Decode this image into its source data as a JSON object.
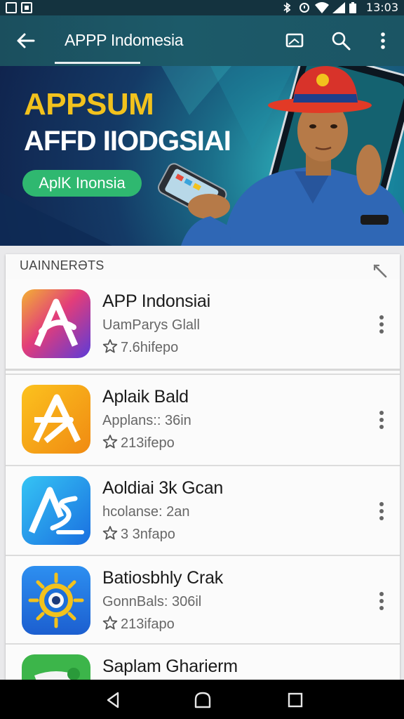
{
  "status_bar": {
    "time": "13:03",
    "icons": [
      "notification-square-icon",
      "image-notification-icon",
      "bluetooth-icon",
      "alarm-icon",
      "wifi-icon",
      "signal-icon",
      "battery-icon"
    ]
  },
  "app_bar": {
    "title": "APPP Indomesia",
    "icons": [
      "back-arrow-icon",
      "cast-icon",
      "search-icon",
      "more-vert-icon"
    ]
  },
  "banner": {
    "headline_1": "APPSUM",
    "headline_2": "AFFD IIODGSIAI",
    "cta_label": "AplK Inonsia"
  },
  "list": {
    "header": "UAINNERƏTS",
    "apps": [
      {
        "name": "APP Indonsiai",
        "developer": "UamParys Glall",
        "rating": "7.6hifepo",
        "icon": "letter-a-gradient-icon"
      },
      {
        "name": "Aplaik Bald",
        "developer": "Applans:: 36in",
        "rating": "213ifepo",
        "icon": "letter-a-orange-icon"
      },
      {
        "name": "Aoldiai 3k Gcan",
        "developer": "hcolanse: 2an",
        "rating": "3 3nfapo",
        "icon": "letter-a-blue-icon"
      },
      {
        "name": "Batiosbhly Crak",
        "developer": "GonnBals: 306il",
        "rating": "213ifapo",
        "icon": "sun-eye-icon"
      },
      {
        "name": "Saplam Gharierm",
        "developer": "",
        "rating": "",
        "icon": "green-app-icon"
      }
    ]
  },
  "colors": {
    "status_bar": "#14333f",
    "app_bar": "#1c5a69",
    "banner_headline": "#f2c21d",
    "cta_green": "#2fb870",
    "list_background": "#fafafa",
    "navigation_bar": "#000000"
  }
}
